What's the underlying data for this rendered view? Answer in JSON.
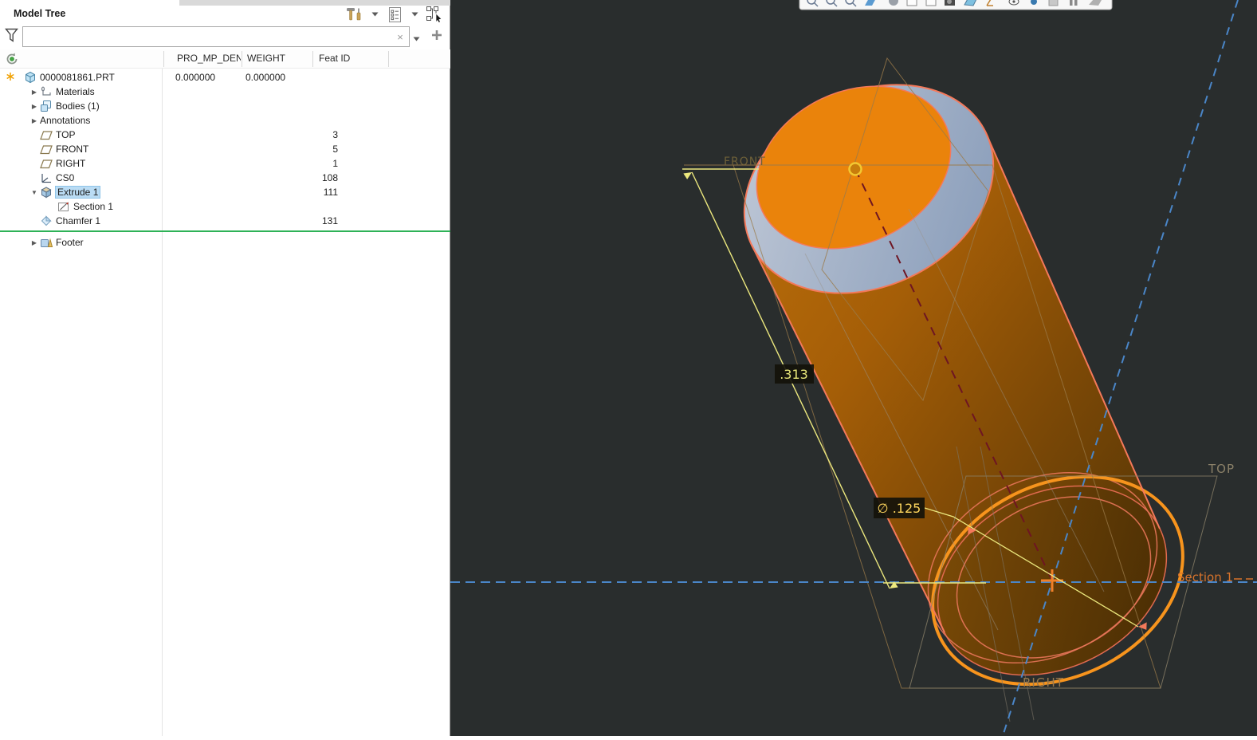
{
  "panel": {
    "title": "Model Tree",
    "toolbar_icons": [
      "tools-icon",
      "tree-filters-icon",
      "tree-columns-icon"
    ],
    "search": {
      "value": "",
      "placeholder": ""
    },
    "columns": {
      "c1": "PRO_MP_DENS",
      "c2": "WEIGHT",
      "c3": "Feat ID"
    },
    "rows": [
      {
        "label": "0000081861.PRT",
        "icon": "part-icon",
        "pro_mp_dens": "0.000000",
        "weight": "0.000000",
        "marker": "regenerate-asterisk"
      },
      {
        "label": "Materials",
        "icon": "materials-icon",
        "state": "collapsed"
      },
      {
        "label": "Bodies (1)",
        "icon": "bodies-icon",
        "state": "collapsed"
      },
      {
        "label": "Annotations",
        "icon": "",
        "state": "collapsed"
      },
      {
        "label": "TOP",
        "icon": "datum-plane-icon",
        "feat_id": "3"
      },
      {
        "label": "FRONT",
        "icon": "datum-plane-icon",
        "feat_id": "5"
      },
      {
        "label": "RIGHT",
        "icon": "datum-plane-icon",
        "feat_id": "1"
      },
      {
        "label": "CS0",
        "icon": "csys-icon",
        "feat_id": "108"
      },
      {
        "label": "Extrude 1",
        "icon": "extrude-icon",
        "state": "expanded",
        "feat_id": "111",
        "selected": true
      },
      {
        "label": "Section 1",
        "icon": "sketch-icon"
      },
      {
        "label": "Chamfer 1",
        "icon": "chamfer-icon",
        "feat_id": "131"
      },
      {
        "label": "Footer",
        "icon": "footer-icon",
        "state": "collapsed"
      }
    ],
    "expand_collapsed_glyph": "▶",
    "expand_expanded_glyph": "▼",
    "clear_glyph": "×"
  },
  "viewport": {
    "datum_labels": {
      "front": "FRONT",
      "top": "TOP",
      "right": "RIGHT",
      "section": "Section 1"
    },
    "dimensions": {
      "length": ".313",
      "diameter": "∅ .125"
    },
    "colors": {
      "background": "#292d2d",
      "cylinder_face": "#ea830b",
      "chamfer_ring": "#a9b6c9",
      "edge_highlight": "#f4795b",
      "sketch_orange": "#f7941d",
      "dimension_yellow": "#ece87e",
      "centerline_blue": "#4a86c8",
      "axis_dark_red": "#6e1522",
      "datum_tan": "#9b7b4a",
      "insert_line_green": "#2eb257",
      "selection_blue": "#badcf4"
    }
  }
}
